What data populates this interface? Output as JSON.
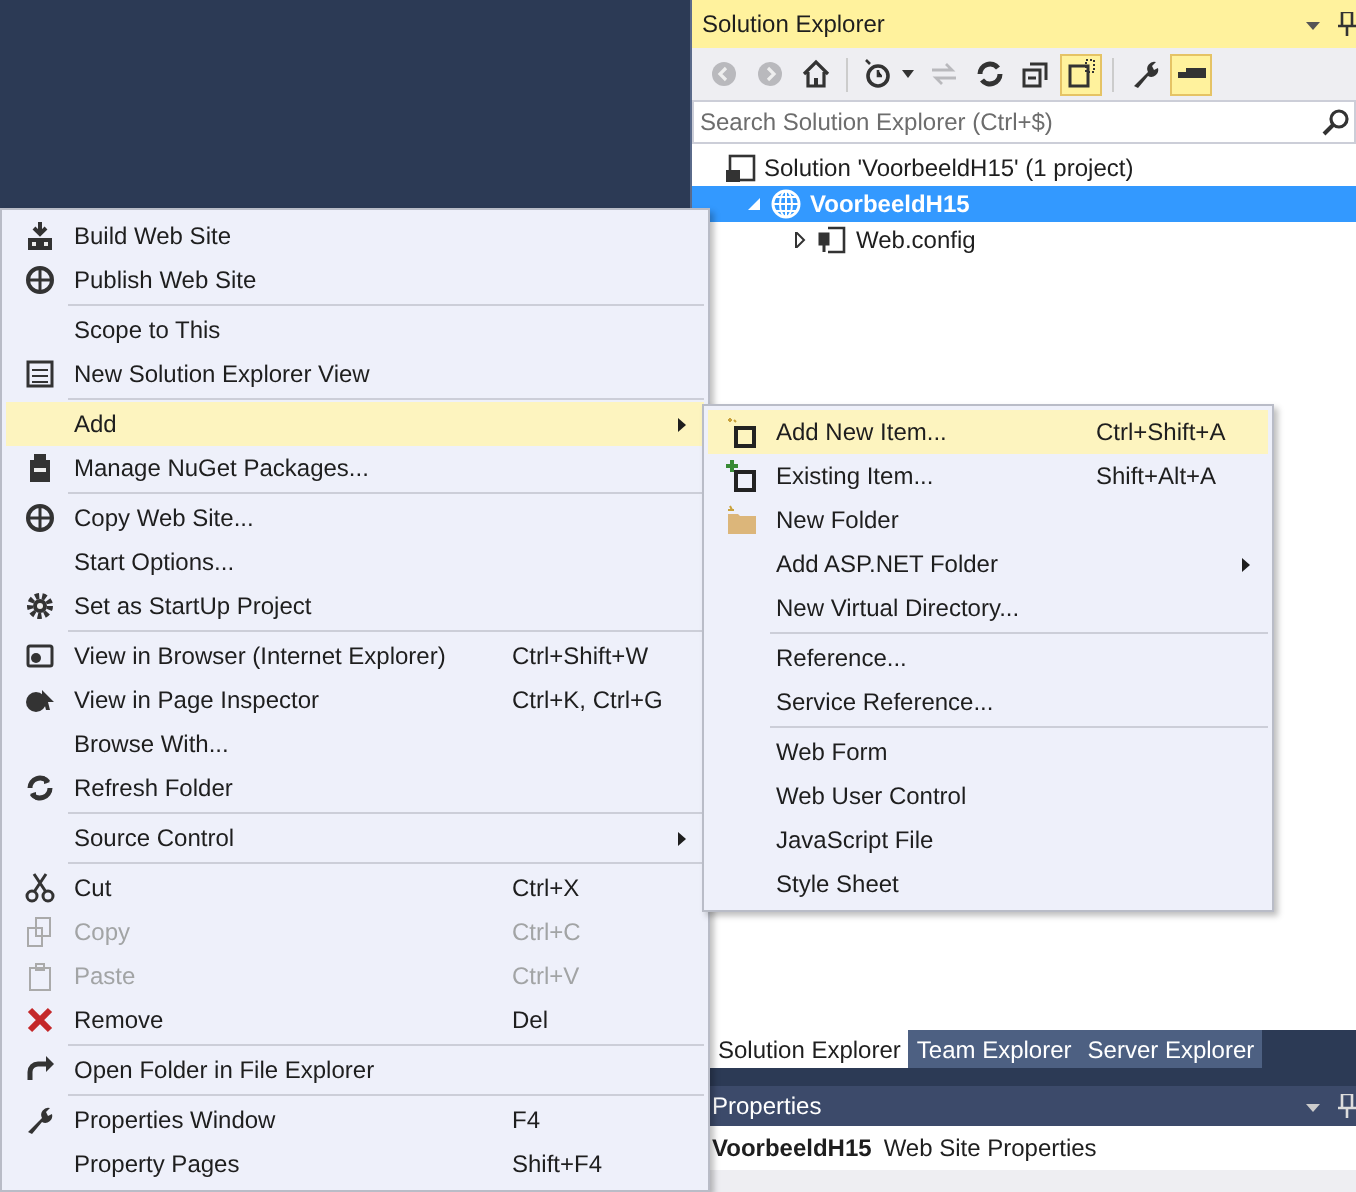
{
  "solution_explorer": {
    "title": "Solution Explorer",
    "toolbar": [
      {
        "disabled": true,
        "on": false
      },
      {
        "disabled": true,
        "on": false
      },
      {
        "disabled": false,
        "on": false
      },
      {
        "disabled": false,
        "on": false
      },
      {
        "disabled": true,
        "on": false
      },
      {
        "disabled": false,
        "on": false
      },
      {
        "disabled": false,
        "on": false
      },
      {
        "disabled": false,
        "on": true
      },
      {
        "disabled": false,
        "on": false
      },
      {
        "disabled": false,
        "on": true
      }
    ],
    "search": {
      "placeholder": "Search Solution Explorer (Ctrl+$)"
    },
    "tree": [
      {
        "label": "Solution 'VoorbeeldH15' (1 project)",
        "selected": false,
        "children": [
          {
            "label": "VoorbeeldH15",
            "selected": true,
            "expanded": true,
            "children": [
              {
                "label": "Web.config",
                "selected": false,
                "expanded": false,
                "has_children": true
              }
            ]
          }
        ]
      }
    ]
  },
  "context_menu": [
    {
      "kind": "item",
      "label": "Build Web Site",
      "disabled": false,
      "selected": false
    },
    {
      "kind": "item",
      "label": "Publish Web Site",
      "disabled": false,
      "selected": false
    },
    {
      "kind": "separator"
    },
    {
      "kind": "item",
      "label": "Scope to This",
      "disabled": false,
      "selected": false
    },
    {
      "kind": "item",
      "label": "New Solution Explorer View",
      "disabled": false,
      "selected": false
    },
    {
      "kind": "separator"
    },
    {
      "kind": "item",
      "label": "Add",
      "disabled": false,
      "selected": true,
      "submenu": true
    },
    {
      "kind": "item",
      "label": "Manage NuGet Packages...",
      "disabled": false,
      "selected": false
    },
    {
      "kind": "separator"
    },
    {
      "kind": "item",
      "label": "Copy Web Site...",
      "disabled": false,
      "selected": false
    },
    {
      "kind": "item",
      "label": "Start Options...",
      "disabled": false,
      "selected": false
    },
    {
      "kind": "item",
      "label": "Set as StartUp Project",
      "disabled": false,
      "selected": false
    },
    {
      "kind": "separator"
    },
    {
      "kind": "item",
      "label": "View in Browser (Internet Explorer)",
      "shortcut": "Ctrl+Shift+W",
      "disabled": false,
      "selected": false
    },
    {
      "kind": "item",
      "label": "View in Page Inspector",
      "shortcut": "Ctrl+K, Ctrl+G",
      "disabled": false,
      "selected": false
    },
    {
      "kind": "item",
      "label": "Browse With...",
      "disabled": false,
      "selected": false
    },
    {
      "kind": "item",
      "label": "Refresh Folder",
      "disabled": false,
      "selected": false
    },
    {
      "kind": "separator"
    },
    {
      "kind": "item",
      "label": "Source Control",
      "disabled": false,
      "selected": false,
      "submenu": true
    },
    {
      "kind": "separator"
    },
    {
      "kind": "item",
      "label": "Cut",
      "shortcut": "Ctrl+X",
      "disabled": false,
      "selected": false
    },
    {
      "kind": "item",
      "label": "Copy",
      "shortcut": "Ctrl+C",
      "disabled": true,
      "selected": false
    },
    {
      "kind": "item",
      "label": "Paste",
      "shortcut": "Ctrl+V",
      "disabled": true,
      "selected": false
    },
    {
      "kind": "item",
      "label": "Remove",
      "shortcut": "Del",
      "disabled": false,
      "selected": false
    },
    {
      "kind": "separator"
    },
    {
      "kind": "item",
      "label": "Open Folder in File Explorer",
      "disabled": false,
      "selected": false
    },
    {
      "kind": "separator"
    },
    {
      "kind": "item",
      "label": "Properties Window",
      "shortcut": "F4",
      "disabled": false,
      "selected": false
    },
    {
      "kind": "item",
      "label": "Property Pages",
      "shortcut": "Shift+F4",
      "disabled": false,
      "selected": false
    }
  ],
  "add_submenu": [
    {
      "kind": "item",
      "label": "Add New Item...",
      "shortcut": "Ctrl+Shift+A",
      "disabled": false,
      "selected": true
    },
    {
      "kind": "item",
      "label": "Existing Item...",
      "shortcut": "Shift+Alt+A",
      "disabled": false,
      "selected": false
    },
    {
      "kind": "item",
      "label": "New Folder",
      "disabled": false,
      "selected": false
    },
    {
      "kind": "item",
      "label": "Add ASP.NET Folder",
      "disabled": false,
      "selected": false,
      "submenu": true
    },
    {
      "kind": "item",
      "label": "New Virtual Directory...",
      "disabled": false,
      "selected": false
    },
    {
      "kind": "separator"
    },
    {
      "kind": "item",
      "label": "Reference...",
      "disabled": false,
      "selected": false
    },
    {
      "kind": "item",
      "label": "Service Reference...",
      "disabled": false,
      "selected": false
    },
    {
      "kind": "separator"
    },
    {
      "kind": "item",
      "label": "Web Form",
      "disabled": false,
      "selected": false
    },
    {
      "kind": "item",
      "label": "Web User Control",
      "disabled": false,
      "selected": false
    },
    {
      "kind": "item",
      "label": "JavaScript File",
      "disabled": false,
      "selected": false
    },
    {
      "kind": "item",
      "label": "Style Sheet",
      "disabled": false,
      "selected": false
    }
  ],
  "tool_tabs": [
    {
      "label": "Solution Explorer",
      "selected": true
    },
    {
      "label": "Team Explorer",
      "selected": false
    },
    {
      "label": "Server Explorer",
      "selected": false
    }
  ],
  "properties": {
    "title": "Properties",
    "object_name": "VoorbeeldH15",
    "object_type": "Web Site Properties"
  }
}
